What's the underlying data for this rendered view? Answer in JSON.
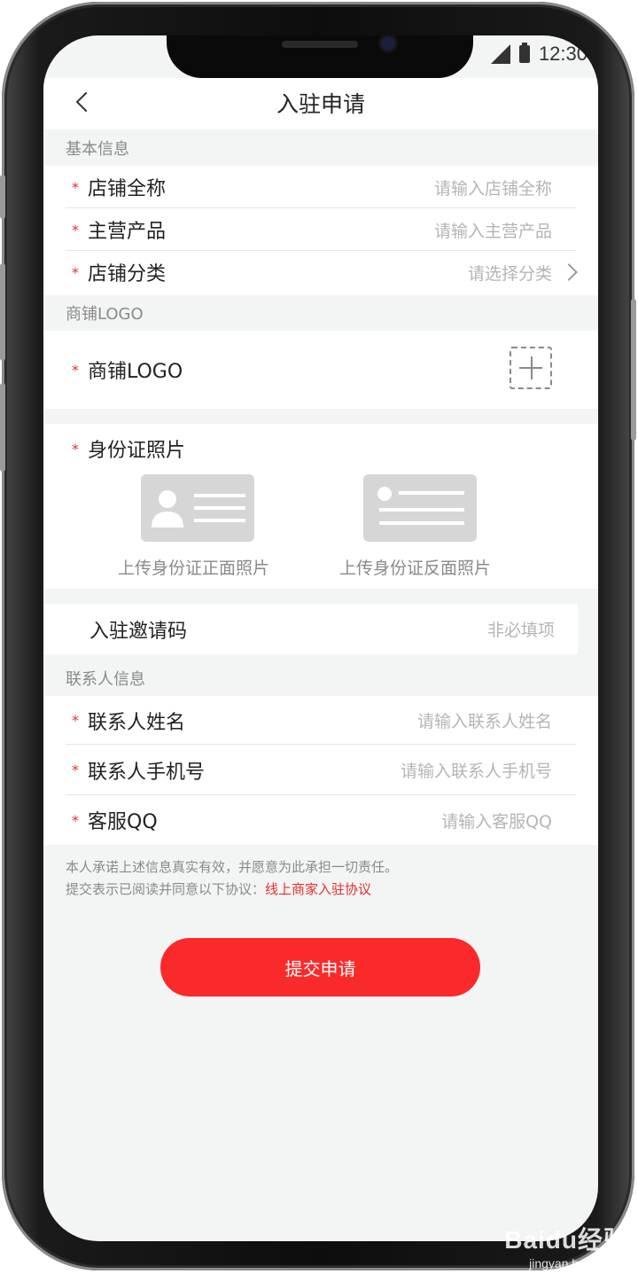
{
  "status_bar": {
    "time": "12:30"
  },
  "nav": {
    "title": "入驻申请"
  },
  "basic": {
    "section_title": "基本信息",
    "rows": [
      {
        "label": "店铺全称",
        "placeholder": "请输入店铺全称"
      },
      {
        "label": "主营产品",
        "placeholder": "请输入主营产品"
      },
      {
        "label": "店铺分类",
        "placeholder": "请选择分类"
      }
    ]
  },
  "logo": {
    "section_title": "商铺LOGO",
    "label": "商铺LOGO"
  },
  "idcard": {
    "label": "身份证照片",
    "front_caption": "上传身份证正面照片",
    "back_caption": "上传身份证反面照片"
  },
  "invite": {
    "label": "入驻邀请码",
    "placeholder": "非必填项"
  },
  "contact": {
    "section_title": "联系人信息",
    "rows": [
      {
        "label": "联系人姓名",
        "placeholder": "请输入联系人姓名"
      },
      {
        "label": "联系人手机号",
        "placeholder": "请输入联系人手机号"
      },
      {
        "label": "客服QQ",
        "placeholder": "请输入客服QQ"
      }
    ]
  },
  "required_mark": "*",
  "agreement": {
    "line1": "本人承诺上述信息真实有效，并愿意为此承担一切责任。",
    "line2_prefix": "提交表示已阅读并同意以下协议：",
    "link": "线上商家入驻协议"
  },
  "submit_label": "提交申请",
  "watermark": {
    "brand": "Baidu经验",
    "url": "jingyan.baidu.com"
  },
  "colors": {
    "accent": "#fb2a2a",
    "required": "#e5302c",
    "background": "#f3f4f4"
  }
}
